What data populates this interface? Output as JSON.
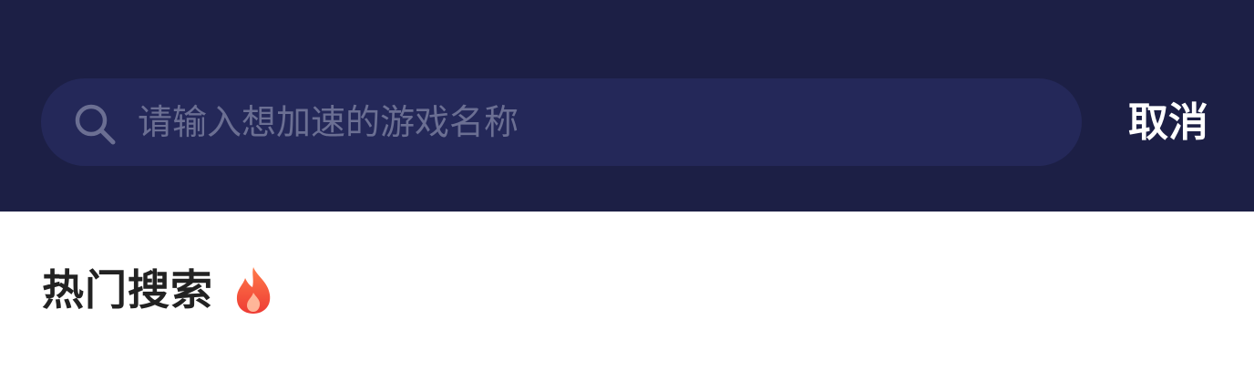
{
  "search": {
    "placeholder": "请输入想加速的游戏名称",
    "value": ""
  },
  "header": {
    "cancel_label": "取消"
  },
  "hot_section": {
    "title": "热门搜索",
    "icon": "fire-icon"
  },
  "colors": {
    "topbar_bg": "#1c1f45",
    "search_bg": "#242859",
    "placeholder": "#6b6f93",
    "fire": "#f2533a"
  },
  "icons": {
    "search": "search-icon"
  }
}
